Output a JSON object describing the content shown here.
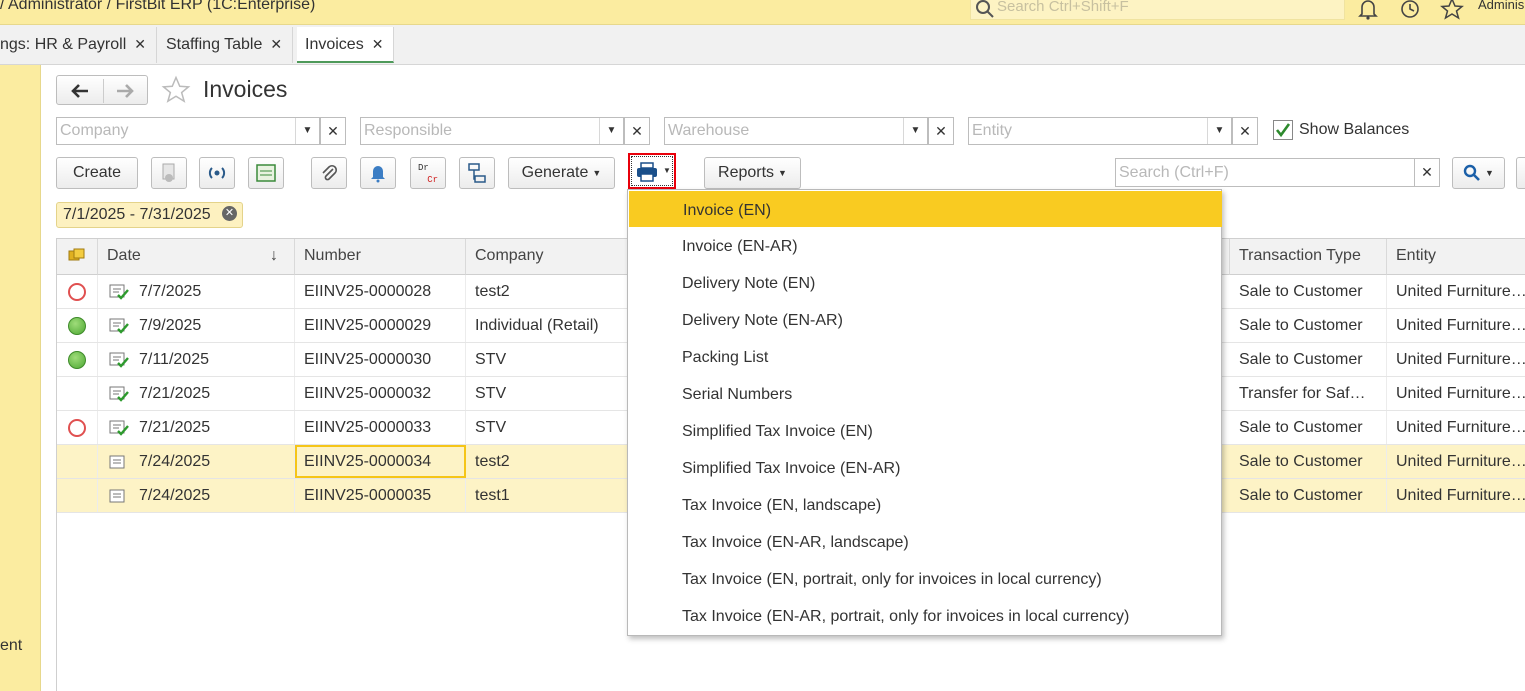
{
  "titlebar": {
    "title": " / Administrator / FirstBit ERP  (1C:Enterprise)",
    "search_placeholder": "Search Ctrl+Shift+F",
    "user": "Adminis"
  },
  "tabs": [
    {
      "label": "ngs: HR & Payroll",
      "close": "✕"
    },
    {
      "label": "Staffing Table",
      "close": "✕"
    },
    {
      "label": "Invoices",
      "close": "✕"
    }
  ],
  "leftpanel": {
    "cut_text": "ent"
  },
  "page": {
    "title": "Invoices"
  },
  "filters": {
    "company_placeholder": "Company",
    "responsible_placeholder": "Responsible",
    "warehouse_placeholder": "Warehouse",
    "entity_placeholder": "Entity",
    "show_balances_label": "Show Balances",
    "show_balances_checked": true
  },
  "toolbar": {
    "create_label": "Create",
    "generate_label": "Generate",
    "reports_label": "Reports",
    "dr_label": "Dr",
    "cr_label": "Cr",
    "search_placeholder": "Search (Ctrl+F)",
    "clear": "✕"
  },
  "period": {
    "label": "7/1/2025 - 7/31/2025",
    "close": "✕"
  },
  "table": {
    "headers": {
      "date": "Date",
      "sort": "↓",
      "number": "Number",
      "company": "Company",
      "transaction_type": "Transaction Type",
      "entity": "Entity"
    },
    "rows": [
      {
        "status": "red",
        "doc": "posted",
        "date": "7/7/2025",
        "number": "EIINV25-0000028",
        "company": "test2",
        "transaction_type": "Sale to Customer",
        "entity": "United Furniture…"
      },
      {
        "status": "green",
        "doc": "posted",
        "date": "7/9/2025",
        "number": "EIINV25-0000029",
        "company": "Individual (Retail)",
        "transaction_type": "Sale to Customer",
        "entity": "United Furniture…"
      },
      {
        "status": "green",
        "doc": "posted",
        "date": "7/11/2025",
        "number": "EIINV25-0000030",
        "company": "STV",
        "transaction_type": "Sale to Customer",
        "entity": "United Furniture…"
      },
      {
        "status": "none",
        "doc": "posted",
        "date": "7/21/2025",
        "number": "EIINV25-0000032",
        "company": "STV",
        "transaction_type": "Transfer for Saf…",
        "entity": "United Furniture…"
      },
      {
        "status": "red",
        "doc": "posted",
        "date": "7/21/2025",
        "number": "EIINV25-0000033",
        "company": "STV",
        "transaction_type": "Sale to Customer",
        "entity": "United Furniture…"
      },
      {
        "status": "none",
        "doc": "draft",
        "date": "7/24/2025",
        "number": "EIINV25-0000034",
        "company": "test2",
        "transaction_type": "Sale to Customer",
        "entity": "United Furniture…"
      },
      {
        "status": "none",
        "doc": "draft",
        "date": "7/24/2025",
        "number": "EIINV25-0000035",
        "company": "test1",
        "transaction_type": "Sale to Customer",
        "entity": "United Furniture…"
      }
    ]
  },
  "print_menu": {
    "items": [
      "Invoice (EN)",
      "Invoice (EN-AR)",
      "Delivery Note (EN)",
      "Delivery Note (EN-AR)",
      "Packing List",
      "Serial Numbers",
      "Simplified Tax Invoice (EN)",
      "Simplified Tax Invoice (EN-AR)",
      "Tax Invoice (EN, landscape)",
      "Tax Invoice (EN-AR, landscape)",
      "Tax Invoice (EN, portrait, only for invoices in local currency)",
      "Tax Invoice (EN-AR, portrait, only for invoices in local currency)"
    ],
    "highlighted_index": 0
  },
  "colors": {
    "accent_yellow": "#f9cb21",
    "panel_yellow": "#fbeca0",
    "highlight_red": "#e8000b",
    "status_green": "#4da833",
    "status_red": "#e05050"
  }
}
